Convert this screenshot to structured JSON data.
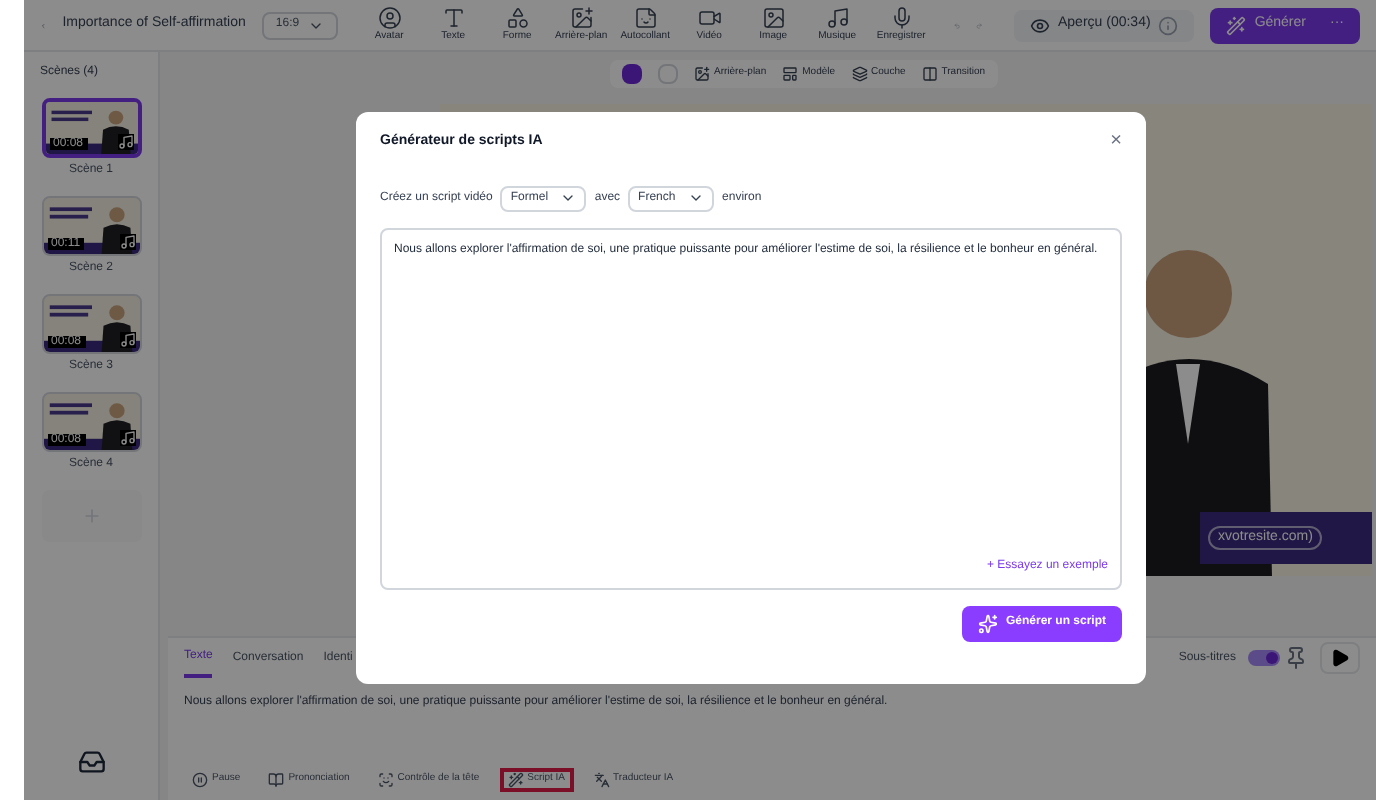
{
  "topbar": {
    "project_title": "Importance of Self-affirmation",
    "aspect": "16:9",
    "tools": [
      {
        "label": "Avatar"
      },
      {
        "label": "Texte"
      },
      {
        "label": "Forme"
      },
      {
        "label": "Arrière-plan"
      },
      {
        "label": "Autocollant"
      },
      {
        "label": "Vidéo"
      },
      {
        "label": "Image"
      },
      {
        "label": "Musique"
      },
      {
        "label": "Enregistrer"
      }
    ],
    "preview_button": "Aperçu (00:34)",
    "generate_button": "Générer",
    "more": "···"
  },
  "sidebar": {
    "title": "Scènes (4)",
    "scenes": [
      {
        "label": "Scène 1",
        "duration": "00:08",
        "selected": true
      },
      {
        "label": "Scène 2",
        "duration": "00:11",
        "selected": false
      },
      {
        "label": "Scène 3",
        "duration": "00:08",
        "selected": false
      },
      {
        "label": "Scène 4",
        "duration": "00:08",
        "selected": false
      }
    ]
  },
  "canvas_toolbar": [
    {
      "label": "Arrière-plan"
    },
    {
      "label": "Modèle"
    },
    {
      "label": "Couche"
    },
    {
      "label": "Transition"
    }
  ],
  "canvas": {
    "url_text": "xvotresite.com)"
  },
  "bottom_panel": {
    "tabs": [
      {
        "label": "Texte",
        "selected": true
      },
      {
        "label": "Conversation",
        "selected": false
      },
      {
        "label": "Identi",
        "selected": false
      }
    ],
    "subtitles": {
      "label": "Sous-titres",
      "on": true
    },
    "script": "Nous allons explorer l'affirmation de soi, une pratique puissante pour améliorer l'estime de soi, la résilience et le bonheur en général.",
    "tools": [
      {
        "label": "Pause",
        "highlighted": false
      },
      {
        "label": "Prononciation",
        "highlighted": false
      },
      {
        "label": "Contrôle de la tête",
        "highlighted": false
      },
      {
        "label": "Script IA",
        "highlighted": true
      },
      {
        "label": "Traducteur IA",
        "highlighted": false
      }
    ]
  },
  "dialog": {
    "title": "Générateur de scripts IA",
    "close": "×",
    "prompt_start": "Créez un script vidéo",
    "tone": "Formel",
    "prompt_middle": "avec",
    "language": "French",
    "prompt_end": "environ",
    "text": "Nous allons explorer l'affirmation de soi, une pratique puissante pour améliorer l'estime de soi, la résilience et le bonheur en général.",
    "example_link": "+ Essayez un exemple",
    "submit": "Générer un script"
  }
}
